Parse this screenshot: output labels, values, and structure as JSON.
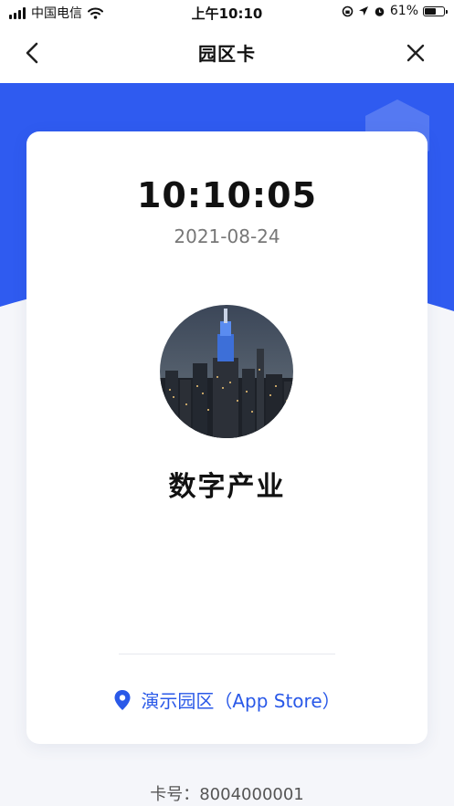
{
  "status_bar": {
    "carrier": "中国电信",
    "time": "上午10:10",
    "battery": "61%",
    "battery_level": 0.61,
    "icons": [
      "signal-icon",
      "wifi-icon",
      "screen-lock-icon",
      "location-arrow-icon",
      "alarm-icon",
      "battery-icon"
    ]
  },
  "nav": {
    "title": "园区卡",
    "back_icon": "chevron-left-icon",
    "close_icon": "close-icon"
  },
  "card": {
    "time": "10:10:05",
    "date": "2021-08-24",
    "org_name": "数字产业",
    "location": "演示园区（App Store）",
    "location_icon": "map-pin-icon",
    "avatar": "city-skyline-photo"
  },
  "card_number": "卡号：8004000001",
  "colors": {
    "accent": "#2a59e8",
    "hero_blue": "#2f5bf0",
    "background": "#f5f6fa"
  }
}
